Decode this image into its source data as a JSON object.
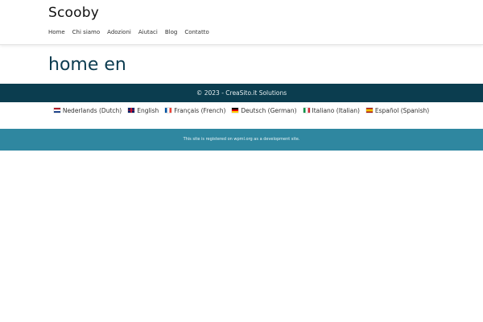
{
  "header": {
    "site_title": "Scooby",
    "nav": [
      {
        "label": "Home"
      },
      {
        "label": "Chi siamo"
      },
      {
        "label": "Adozioni"
      },
      {
        "label": "Aiutaci"
      },
      {
        "label": "Blog"
      },
      {
        "label": "Contatto"
      }
    ]
  },
  "main": {
    "heading": "home en"
  },
  "footer": {
    "copyright": "© 2023 - CreaSito.it Solutions",
    "languages": [
      {
        "label": "Nederlands (Dutch)",
        "flag": "nl-flag-icon"
      },
      {
        "label": "English",
        "flag": "uk-flag-icon"
      },
      {
        "label": "Français (French)",
        "flag": "fr-flag-icon"
      },
      {
        "label": "Deutsch (German)",
        "flag": "de-flag-icon"
      },
      {
        "label": "Italiano (Italian)",
        "flag": "it-flag-icon"
      },
      {
        "label": "Español (Spanish)",
        "flag": "es-flag-icon"
      }
    ],
    "notice": "This site is registered on wpml.org as a development site."
  },
  "colors": {
    "heading": "#0c3c50",
    "footer_dark": "#0b3d4f",
    "footer_light": "#2f87a0"
  }
}
